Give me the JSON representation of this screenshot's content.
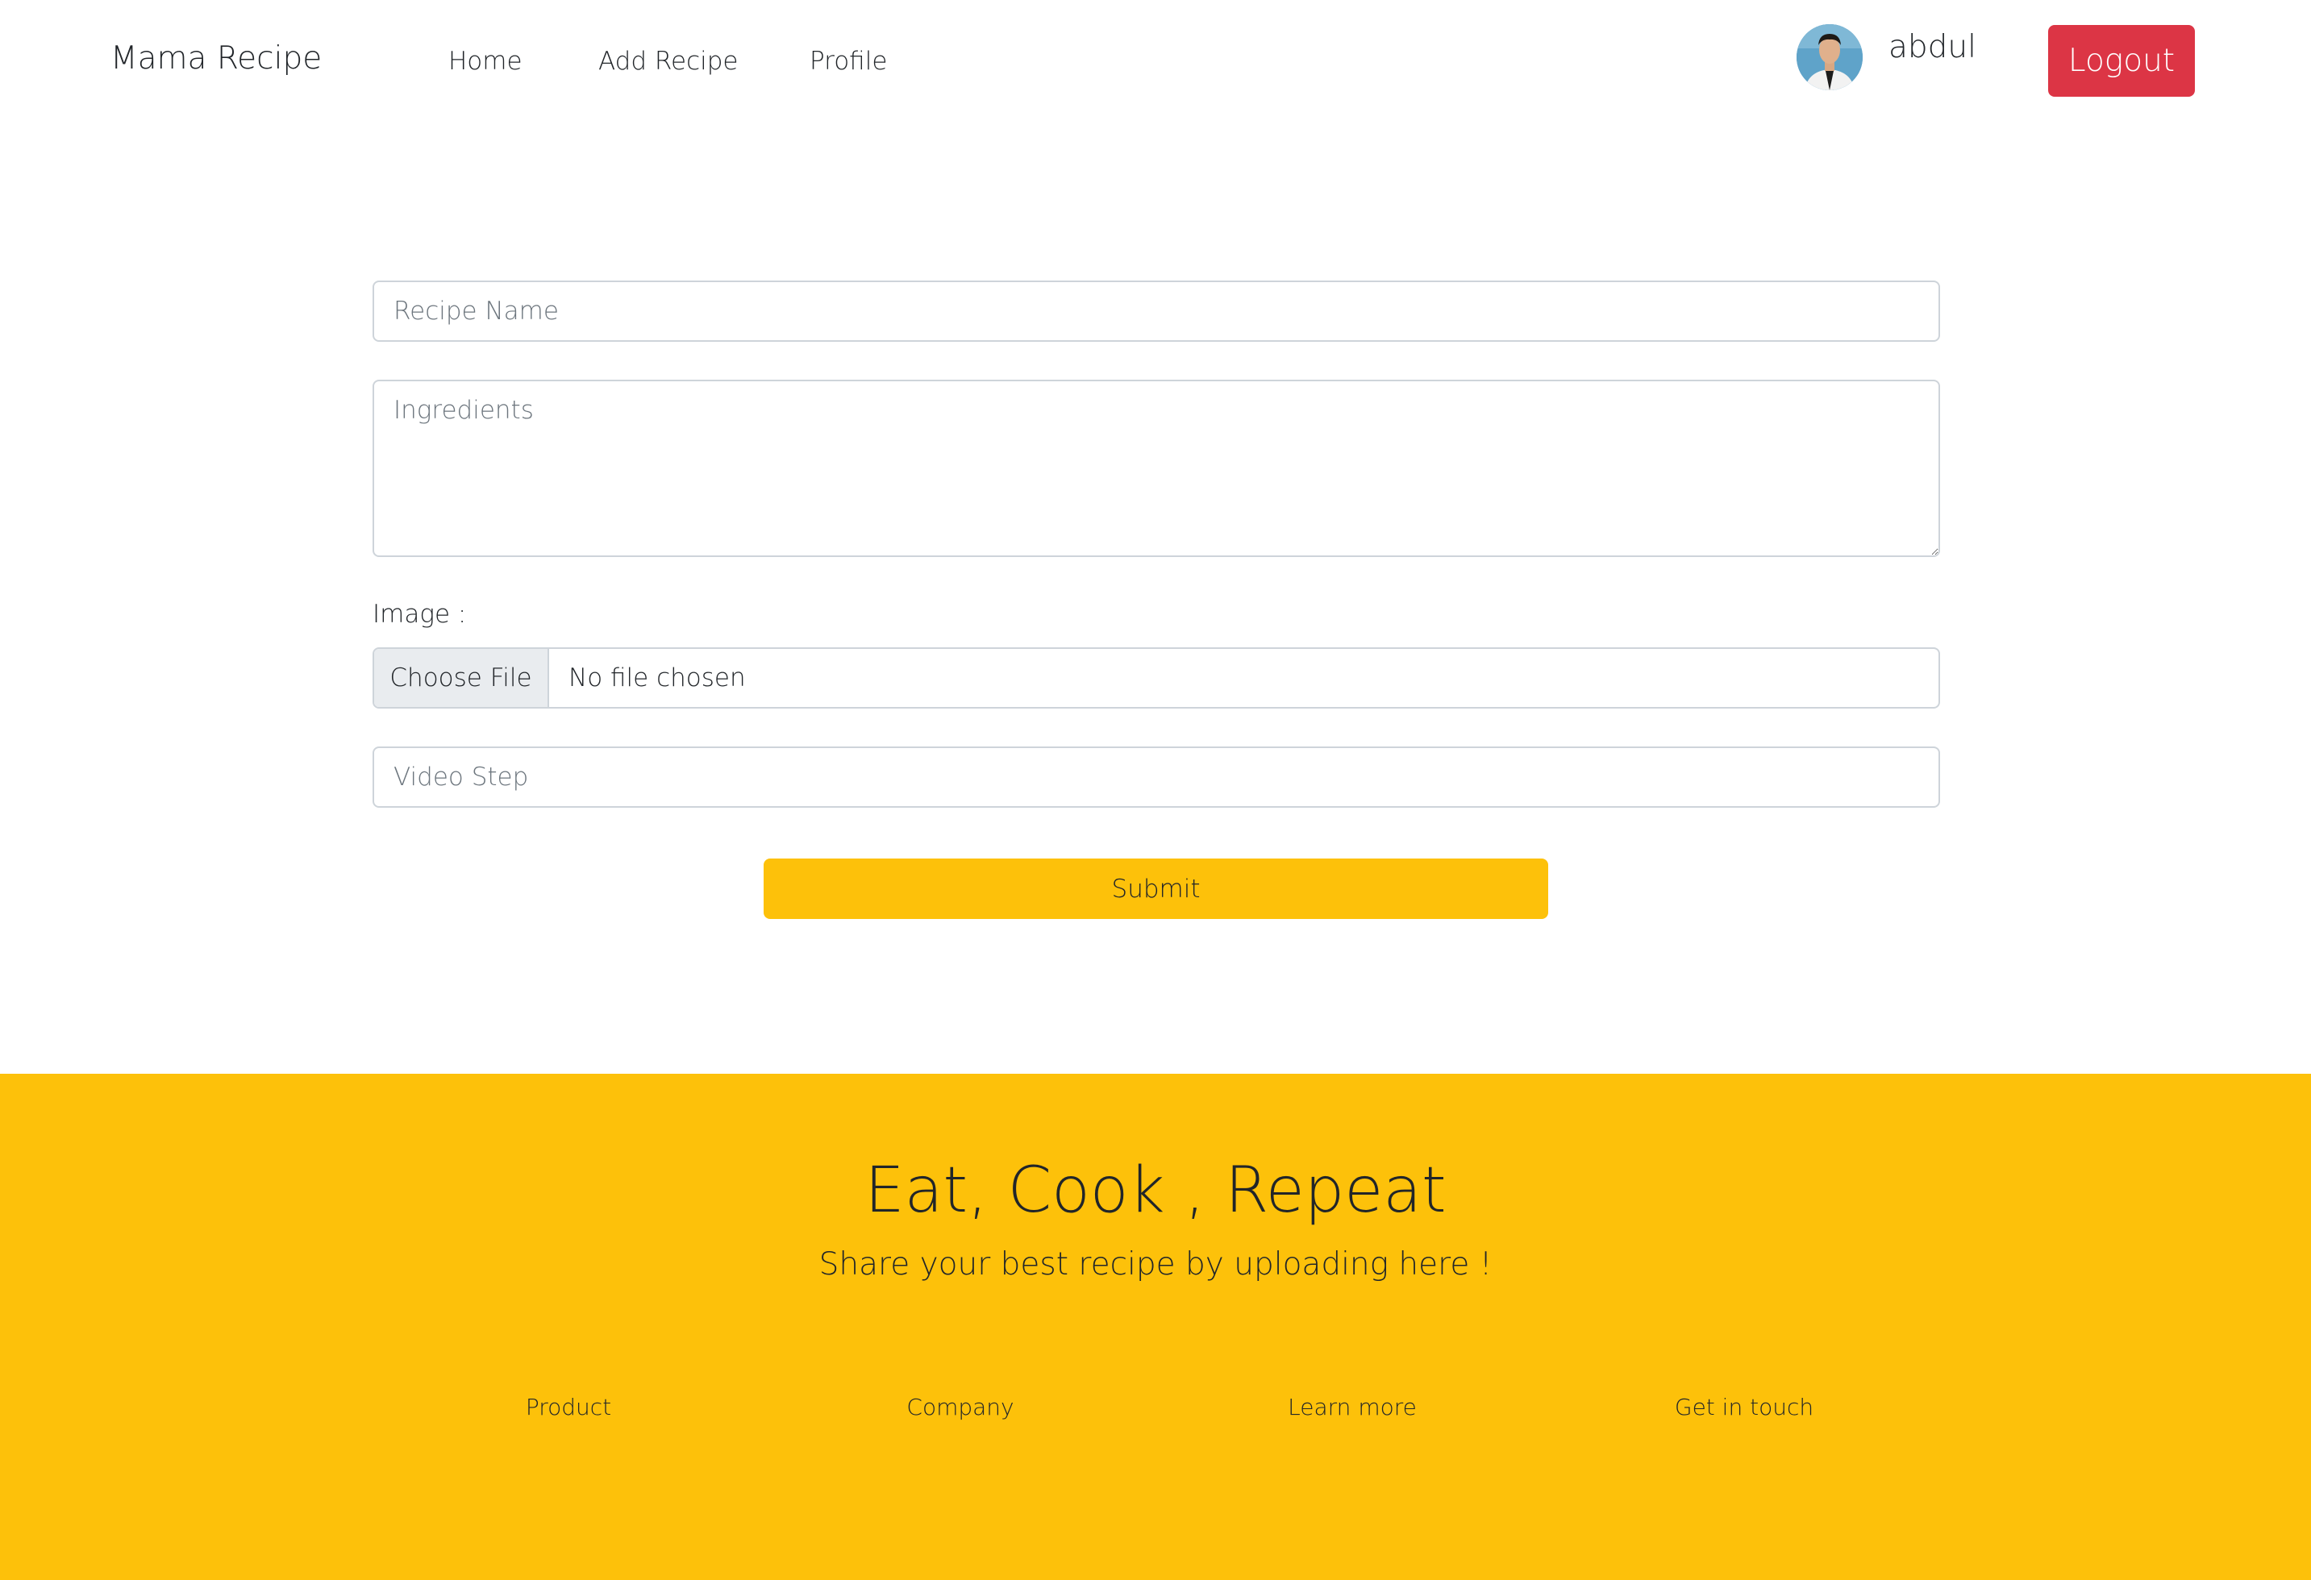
{
  "navbar": {
    "brand": "Mama Recipe",
    "links": [
      {
        "label": "Home"
      },
      {
        "label": "Add Recipe"
      },
      {
        "label": "Profile"
      }
    ],
    "user": {
      "name": "abdul"
    },
    "logout_label": "Logout"
  },
  "form": {
    "recipe_name": {
      "placeholder": "Recipe Name",
      "value": ""
    },
    "ingredients": {
      "placeholder": "Ingredients",
      "value": ""
    },
    "image_label": "Image :",
    "file": {
      "button_label": "Choose File",
      "status": "No file chosen"
    },
    "video_step": {
      "placeholder": "Video Step",
      "value": ""
    },
    "submit_label": "Submit"
  },
  "footer": {
    "title": "Eat, Cook , Repeat",
    "subtitle": "Share your best recipe by uploading here !",
    "links": [
      {
        "label": "Product"
      },
      {
        "label": "Company"
      },
      {
        "label": "Learn more"
      },
      {
        "label": "Get in touch"
      }
    ]
  },
  "colors": {
    "accent": "#fdc10a",
    "danger": "#dc3545",
    "text": "#212529",
    "input_border": "#ced4da",
    "placeholder": "#6c757d"
  }
}
